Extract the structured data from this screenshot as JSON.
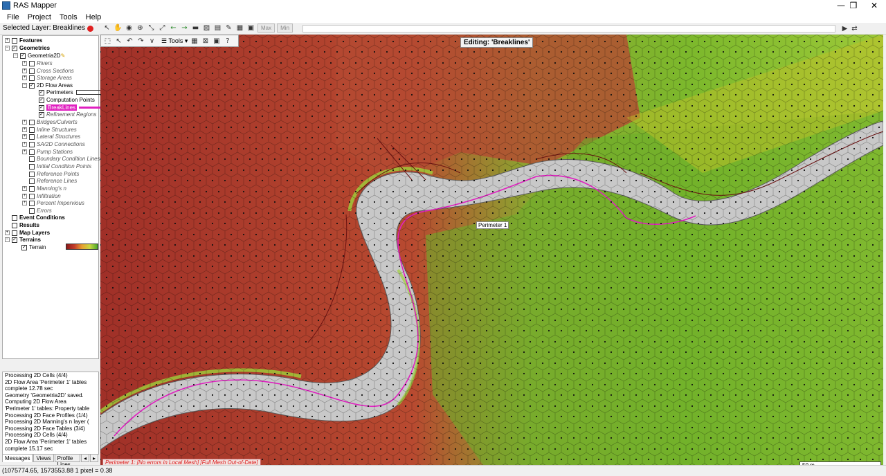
{
  "window": {
    "title": "RAS Mapper",
    "minimize": "—",
    "restore": "❒",
    "close": "✕"
  },
  "menu": [
    "File",
    "Project",
    "Tools",
    "Help"
  ],
  "toolbar": {
    "selected_layer": "Selected Layer: Breaklines",
    "max_label": "Max",
    "min_label": "Min"
  },
  "tree": {
    "features": "Features",
    "geometries": "Geometries",
    "geometry_name": "Geometria2D",
    "rivers": "Rivers",
    "cross_sections": "Cross Sections",
    "storage_areas": "Storage Areas",
    "flow_areas": "2D Flow Areas",
    "perimeters": "Perimeters",
    "computation_points": "Computation Points",
    "breaklines": "BreakLines",
    "refinement_regions": "Refinement Regions",
    "bridges": "Bridges/Culverts",
    "inline": "Inline Structures",
    "lateral": "Lateral Structures",
    "sa2d": "SA/2D Connections",
    "pump": "Pump Stations",
    "bc_lines": "Boundary Condition Lines",
    "ic_points": "Initial Condition Points",
    "ref_points": "Reference Points",
    "ref_lines": "Reference Lines",
    "mannings": "Manning's n",
    "infiltration": "Infiltration",
    "impervious": "Percent Impervious",
    "errors": "Errors",
    "event_conditions": "Event Conditions",
    "results": "Results",
    "map_layers": "Map Layers",
    "terrains": "Terrains",
    "terrain": "Terrain"
  },
  "messages": [
    "Processing 2D Cells (4/4)",
    "2D Flow Area 'Perimeter 1' tables",
    "complete 12.78 sec",
    "Geometry 'Geometria2D' saved.",
    "Computing 2D Flow Area",
    "'Perimeter 1' tables: Property table",
    "Processing 2D Face Profiles (1/4)",
    "Processing 2D Manning's n layer (",
    "Processing 2D Face Tables (3/4)",
    "Processing 2D Cells (4/4)",
    "2D Flow Area 'Perimeter 1' tables",
    "complete 15.17 sec"
  ],
  "tabs": [
    "Messages",
    "Views",
    "Profile Lines"
  ],
  "map": {
    "tools_label": "Tools",
    "editing": "Editing: 'Breaklines'",
    "perimeter_label": "Perimeter 1",
    "status": "Perimeter 1: [No errors in Local Mesh]  [Full Mesh Out-of-Date]",
    "scale": "50 m"
  },
  "statusbar": "(1075774.65, 1573553.88  1 pixel = 0.38"
}
